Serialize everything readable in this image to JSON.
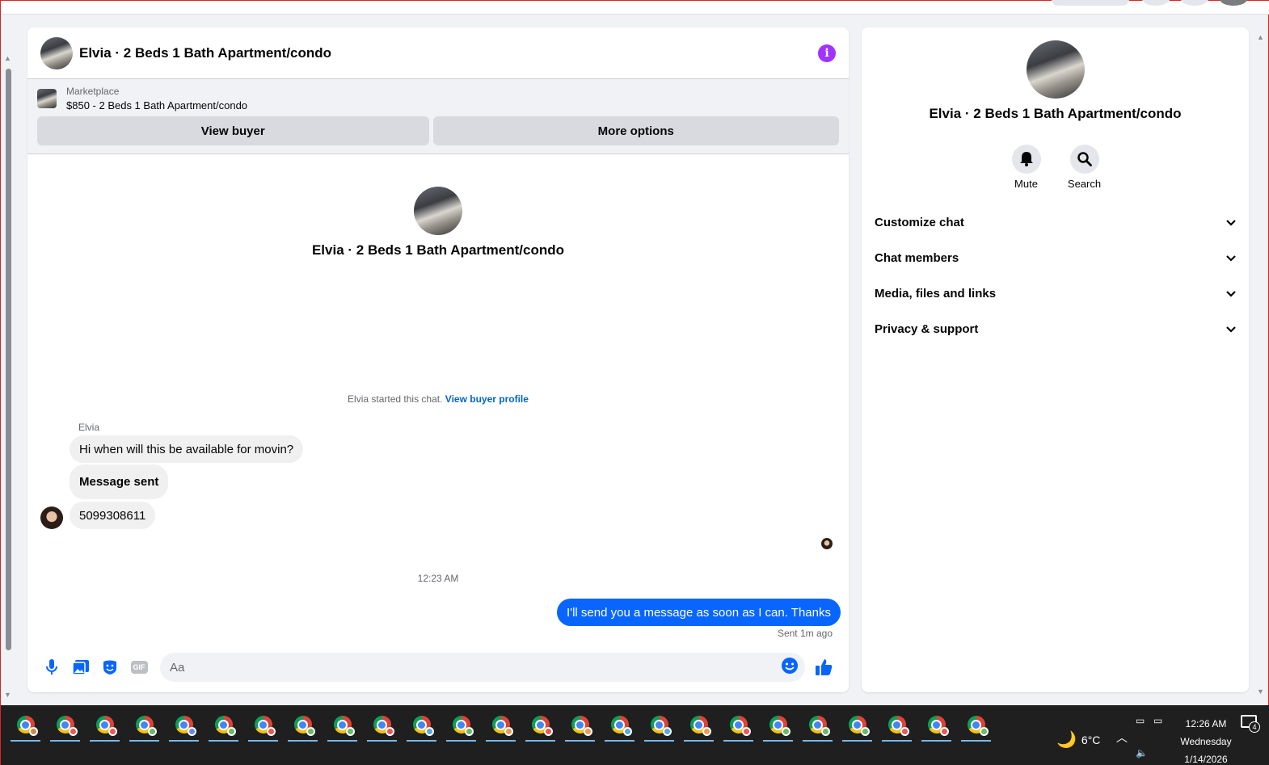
{
  "chat": {
    "title": "Elvia · 2 Beds 1 Bath Apartment/condo",
    "marketplace_label": "Marketplace",
    "listing_title": "$850 - 2 Beds 1 Bath Apartment/condo",
    "view_buyer_label": "View buyer",
    "more_options_label": "More options",
    "center_name": "Elvia · 2 Beds 1 Bath Apartment/condo",
    "started_text": "Elvia started this chat.",
    "view_profile_link": "View buyer profile",
    "sender_name": "Elvia",
    "incoming": [
      "Hi when will this be available for movin?",
      "Message sent",
      "5099308611"
    ],
    "timestamp": "12:23 AM",
    "outgoing": "I'll send you a message as soon as I can. Thanks",
    "sent_status": "Sent 1m ago",
    "composer_placeholder": "Aa",
    "gif_label": "GIF"
  },
  "side": {
    "name": "Elvia · 2 Beds 1 Bath Apartment/condo",
    "actions": [
      {
        "label": "Mute",
        "icon": "bell-icon"
      },
      {
        "label": "Search",
        "icon": "search-icon"
      }
    ],
    "sections": [
      "Customize chat",
      "Chat members",
      "Media, files and links",
      "Privacy & support"
    ]
  },
  "taskbar": {
    "weather_temp": "6°C",
    "time": "12:26 AM",
    "day": "Wednesday",
    "date": "1/14/2026",
    "notification_count": "4",
    "app_badge_colors": [
      "#c85",
      "#e55",
      "#e55",
      "#6b6",
      "#68e",
      "#6b6",
      "#e55",
      "#6b6",
      "#6b6",
      "#e55",
      "#5ad",
      "#6b6",
      "#e95",
      "#e55",
      "#e95",
      "#5ad",
      "#5ad",
      "#e95",
      "#e55",
      "#6b6",
      "#6b6",
      "#6b6",
      "#e55",
      "#e55",
      "#6b6"
    ]
  },
  "colors": {
    "accent": "#0866ff",
    "info": "#a033ff",
    "link": "#0064d1"
  }
}
